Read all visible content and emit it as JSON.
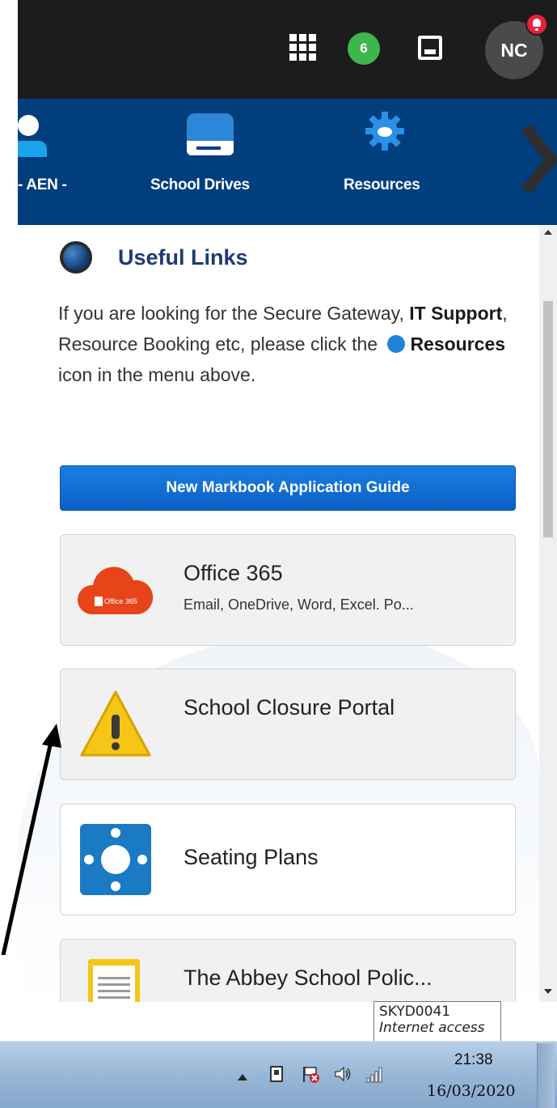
{
  "topbar": {
    "notification_count": "6",
    "user_initials": "NC"
  },
  "nav": {
    "items": [
      {
        "label": "- AEN -"
      },
      {
        "label": "School Drives"
      },
      {
        "label": "Resources"
      }
    ]
  },
  "useful_links": {
    "title": "Useful Links",
    "intro_part1": "If you are looking for the Secure Gateway, ",
    "intro_bold1": "IT Support",
    "intro_part2": ", Resource Booking etc, please click the ",
    "intro_bold2": "Resources",
    "intro_part3": " icon in the menu above.",
    "guide_button": "New Markbook Application Guide",
    "cards": [
      {
        "title": "Office 365",
        "subtitle": "Email, OneDrive, Word, Excel. Po...",
        "icon_label": "Office 365"
      },
      {
        "title": "School Closure Portal",
        "subtitle": ""
      },
      {
        "title": "Seating Plans",
        "subtitle": ""
      },
      {
        "title": "The Abbey School Polic...",
        "subtitle": ""
      }
    ]
  },
  "tooltip": {
    "line1": "SKYD0041",
    "line2": "Internet access"
  },
  "taskbar": {
    "time": "21:38",
    "date": "16/03/2020"
  },
  "colors": {
    "topbar": "#1c1c1c",
    "navbar": "#003e7e",
    "badge": "#3eb64b",
    "guide_button": "#0d5fc4",
    "notification": "#e6213b"
  }
}
